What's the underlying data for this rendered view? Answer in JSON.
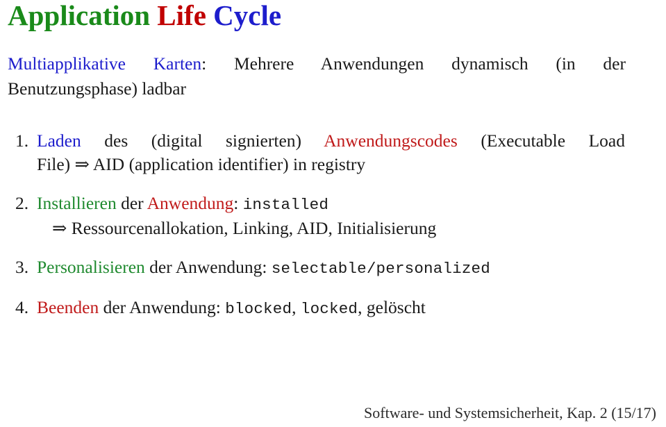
{
  "slide": {
    "title": {
      "word1": "Application",
      "word2": "Life",
      "word3": "Cycle",
      "color1": "#1a8a1a",
      "color2": "#c00000",
      "color3": "#1d1dcc"
    },
    "subtitle": {
      "highlight": "Multiapplikative Karten",
      "rest_line1": ": Mehrere Anwendungen dynamisch (in der",
      "line2": "Benutzungsphase) ladbar",
      "highlight_color": "#1d1dcc"
    },
    "items": [
      {
        "number": "1.",
        "keyword": "Laden",
        "keyword_color": "#1d1dcc",
        "text_a": " des (digital signierten) ",
        "emphasis": "Anwendungscodes",
        "emphasis_color": "#c01a1a",
        "text_b": " (Executable Load",
        "line2": "File) ⇒ AID (application identifier) in registry"
      },
      {
        "number": "2.",
        "keyword": "Installieren",
        "keyword_color": "#1f8a2f",
        "text_a": " der ",
        "emphasis": "Anwendung",
        "emphasis_color": "#c01a1a",
        "text_b": ": ",
        "code": "installed",
        "subline_arrow": "⇒",
        "subline": " Ressourcenallokation, Linking, AID, Initialisierung"
      },
      {
        "number": "3.",
        "keyword": "Personalisieren",
        "keyword_color": "#1f8a2f",
        "text_a": " der Anwendung: ",
        "code": "selectable/personalized"
      },
      {
        "number": "4.",
        "keyword": "Beenden",
        "keyword_color": "#c01a1a",
        "text_a": " der Anwendung: ",
        "code1": "blocked",
        "sep1": ", ",
        "code2": "locked",
        "sep2": ", ",
        "tail": "gelöscht"
      }
    ],
    "footer": "Software- und Systemsicherheit, Kap. 2 (15/17)"
  }
}
